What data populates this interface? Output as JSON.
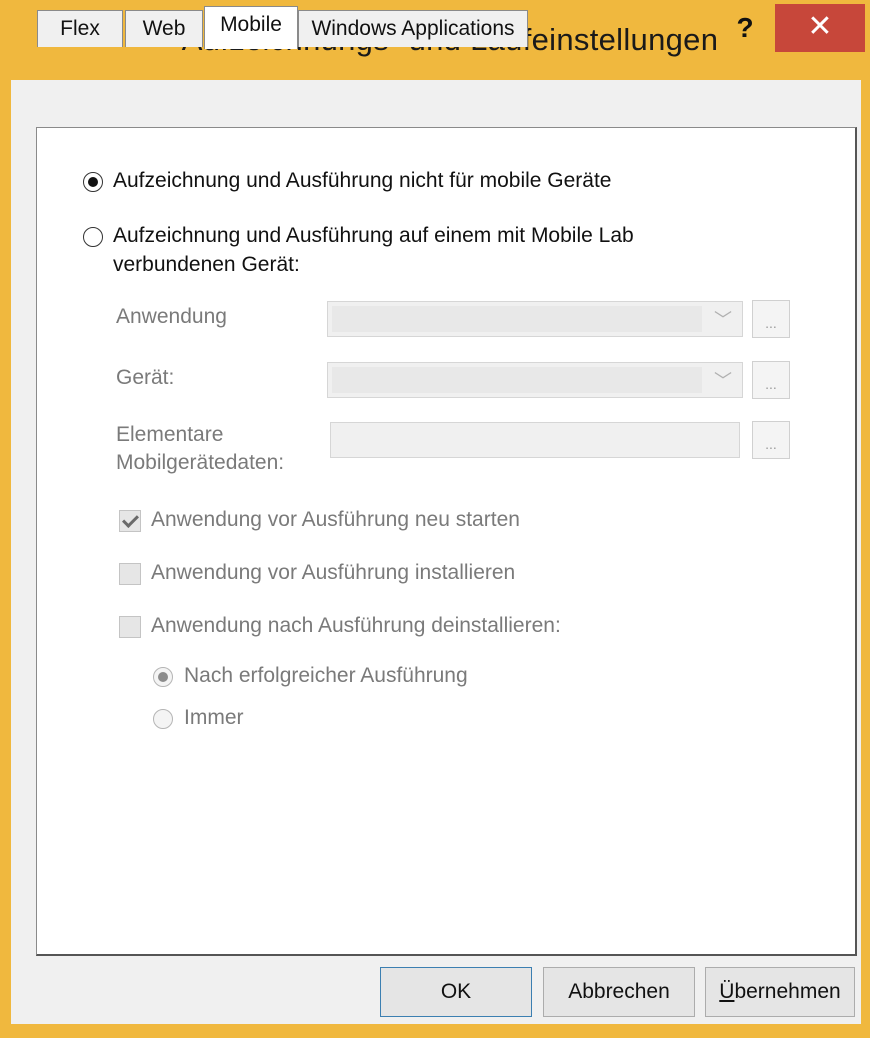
{
  "window": {
    "title": "Aufzeichnungs- und Laufeinstellungen",
    "help_label": "?",
    "close_label": "✕"
  },
  "tabs": [
    {
      "label": "Flex",
      "active": false
    },
    {
      "label": "Web",
      "active": false
    },
    {
      "label": "Mobile",
      "active": true
    },
    {
      "label": "Windows Applications",
      "active": false
    }
  ],
  "mobile": {
    "option_none": {
      "label": "Aufzeichnung und Ausführung nicht für mobile Geräte",
      "selected": true
    },
    "option_lab": {
      "label_line1": "Aufzeichnung und Ausführung auf einem mit Mobile Lab",
      "label_line2": "verbundenen Gerät:",
      "selected": false
    },
    "fields": {
      "application_label": "Anwendung",
      "application_value": "",
      "device_label": "Gerät:",
      "device_value": "",
      "basic_data_label_line1": "Elementare",
      "basic_data_label_line2": "Mobilgerätedaten:",
      "basic_data_value": "",
      "browse_label": "..."
    },
    "checkboxes": {
      "restart_app": {
        "label": "Anwendung vor Ausführung neu starten",
        "checked": true
      },
      "install_app": {
        "label": "Anwendung vor Ausführung installieren",
        "checked": false
      },
      "uninstall_app": {
        "label": "Anwendung nach Ausführung deinstallieren:",
        "checked": false
      }
    },
    "uninstall_options": {
      "after_success": {
        "label": "Nach erfolgreicher Ausführung",
        "selected": true
      },
      "always": {
        "label": "Immer",
        "selected": false
      }
    }
  },
  "buttons": {
    "ok": "OK",
    "cancel": "Abbrechen",
    "apply_underlined": "Ü",
    "apply_rest": "bernehmen"
  }
}
